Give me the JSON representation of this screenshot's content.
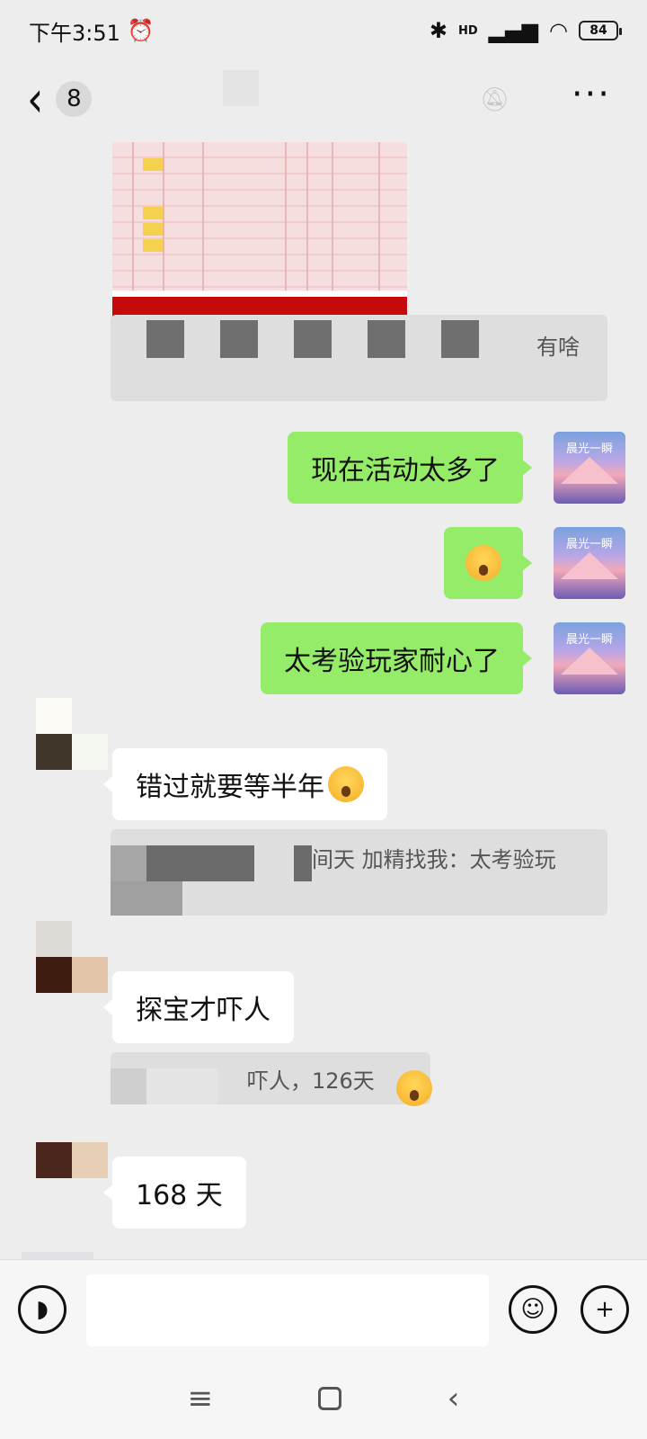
{
  "status_bar": {
    "time": "下午3:51",
    "alarm_icon": "alarm-clock-icon",
    "bluetooth_icon": "bluetooth-icon",
    "signal_label": "HD",
    "wifi_icon": "wifi-icon",
    "battery": "84"
  },
  "header": {
    "back_icon": "back-chevron-icon",
    "unread_count": "8",
    "mute_icon": "bell-muted-icon",
    "more_icon": "more-dots-icon"
  },
  "messages": {
    "quote1_text": "有啥",
    "m1": "现在活动太多了",
    "m3": "太考验玩家耐心了",
    "m4": "错过就要等半年",
    "quote2_text": "间天 加精找我：太考验玩",
    "m5": "探宝才吓人",
    "quote3_text": "吓人，126天",
    "m6": "168 天"
  },
  "input_bar": {
    "voice_icon": "voice-icon",
    "emoji_icon": "emoji-icon",
    "plus_icon": "plus-icon"
  },
  "nav_bar": {
    "menu_icon": "menu-icon",
    "home_icon": "home-icon",
    "back_icon": "back-icon"
  },
  "colors": {
    "sent_bubble": "#95ec69",
    "received_bubble": "#ffffff",
    "background": "#ededed"
  }
}
